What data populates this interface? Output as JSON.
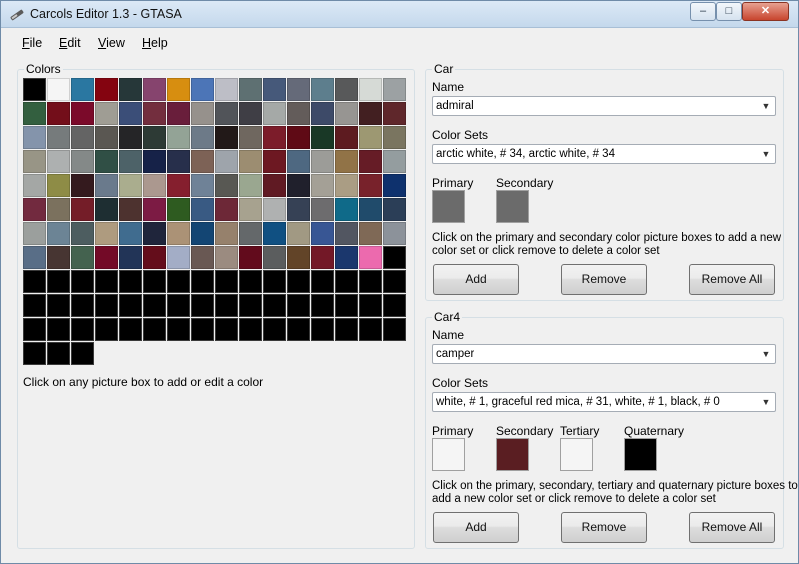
{
  "window": {
    "title": "Carcols Editor 1.3 - GTASA",
    "min": "–",
    "max": "□",
    "close": "✕"
  },
  "menu": [
    {
      "u": "F",
      "rest": "ile"
    },
    {
      "u": "E",
      "rest": "dit"
    },
    {
      "u": "V",
      "rest": "iew"
    },
    {
      "u": "H",
      "rest": "elp"
    }
  ],
  "colors_panel": {
    "title": "Colors",
    "hint": "Click on any picture box to add or edit a color",
    "swatches": [
      "#000000",
      "#f5f5f5",
      "#2a77a1",
      "#840410",
      "#263739",
      "#86446e",
      "#d78e10",
      "#4c75b7",
      "#bdbec6",
      "#5e7072",
      "#46597a",
      "#656a79",
      "#5d7e8d",
      "#58595a",
      "#d6dad6",
      "#9ca1a3",
      "#335f3f",
      "#730e1a",
      "#7b0a2a",
      "#9f9d94",
      "#3b4e78",
      "#732e3e",
      "#691e3b",
      "#96918c",
      "#515459",
      "#3f3e45",
      "#a5a9a7",
      "#635c5a",
      "#3d4a68",
      "#979592",
      "#421f21",
      "#5f272b",
      "#8494ab",
      "#767b7c",
      "#646464",
      "#5a5752",
      "#252527",
      "#2d3a35",
      "#93a396",
      "#6d7a88",
      "#221918",
      "#6f675f",
      "#7c1c2a",
      "#5f0a15",
      "#193826",
      "#5d1b20",
      "#9d9872",
      "#7a7560",
      "#989586",
      "#adb0b0",
      "#848988",
      "#304f45",
      "#4d6268",
      "#162248",
      "#272f4b",
      "#7d6256",
      "#9ea4ab",
      "#9c8d71",
      "#6d1822",
      "#4e6881",
      "#9c9c98",
      "#917347",
      "#661c26",
      "#949d9f",
      "#a4a7a5",
      "#8e8c46",
      "#341a1e",
      "#6a7a8c",
      "#aaad8e",
      "#ab988f",
      "#851f2e",
      "#6f8297",
      "#585853",
      "#9aa790",
      "#601a23",
      "#20202c",
      "#a4a096",
      "#aa9d84",
      "#78222b",
      "#0e316d",
      "#722a3f",
      "#7b715e",
      "#741d28",
      "#1e2e32",
      "#4d322f",
      "#7c1b44",
      "#2e5b20",
      "#395a83",
      "#6d2837",
      "#a7a28f",
      "#afb1b1",
      "#364155",
      "#6d6c6e",
      "#0f6a89",
      "#204b6b",
      "#2b3e57",
      "#9b9f9d",
      "#6c8495",
      "#4d5d60",
      "#ae9b7f",
      "#406c8f",
      "#1f253b",
      "#ab9276",
      "#134573",
      "#96816c",
      "#64686a",
      "#105082",
      "#a19983",
      "#385694",
      "#525661",
      "#7f6956",
      "#8c929a",
      "#596e87",
      "#473532",
      "#44624f",
      "#730a27",
      "#223457",
      "#640d1b",
      "#a3adc6",
      "#695853",
      "#9b8b80",
      "#620b1c",
      "#5b5d5e",
      "#624428",
      "#731827",
      "#1b376d",
      "#ec6aae",
      "#000000",
      "#000000",
      "#000000",
      "#000000",
      "#000000",
      "#000000",
      "#000000",
      "#000000",
      "#000000",
      "#000000",
      "#000000",
      "#000000",
      "#000000",
      "#000000",
      "#000000",
      "#000000",
      "#000000",
      "#000000",
      "#000000",
      "#000000",
      "#000000",
      "#000000",
      "#000000",
      "#000000",
      "#000000",
      "#000000",
      "#000000",
      "#000000",
      "#000000",
      "#000000",
      "#000000",
      "#000000",
      "#000000",
      "#000000",
      "#000000",
      "#000000",
      "#000000",
      "#000000",
      "#000000",
      "#000000",
      "#000000",
      "#000000",
      "#000000",
      "#000000",
      "#000000",
      "#000000",
      "#000000",
      "#000000",
      "#000000",
      "#000000",
      "#000000",
      "#000000"
    ]
  },
  "car_panel": {
    "title": "Car",
    "name_label": "Name",
    "name_value": "admiral",
    "color_sets_label": "Color Sets",
    "color_sets_value": "arctic white, # 34, arctic white, # 34",
    "primary_label": "Primary",
    "secondary_label": "Secondary",
    "primary_color": "#6b6b6b",
    "secondary_color": "#6b6b6b",
    "hint_line1": "Click on the primary and secondary color picture boxes to add a new",
    "hint_line2": "color set or click remove to delete a color set",
    "add": "Add",
    "remove": "Remove",
    "remove_all": "Remove All"
  },
  "car4_panel": {
    "title": "Car4",
    "name_label": "Name",
    "name_value": "camper",
    "color_sets_label": "Color Sets",
    "color_sets_value": "white, # 1, graceful red mica, # 31, white, # 1, black, # 0",
    "primary_label": "Primary",
    "secondary_label": "Secondary",
    "tertiary_label": "Tertiary",
    "quaternary_label": "Quaternary",
    "primary_color": "#f5f5f5",
    "secondary_color": "#5a1e22",
    "tertiary_color": "#f5f5f5",
    "quaternary_color": "#000000",
    "hint_line1": "Click on the primary, secondary, tertiary and quaternary picture boxes to",
    "hint_line2": "add a new color set or click remove to delete a color set",
    "add": "Add",
    "remove": "Remove",
    "remove_all": "Remove All"
  }
}
